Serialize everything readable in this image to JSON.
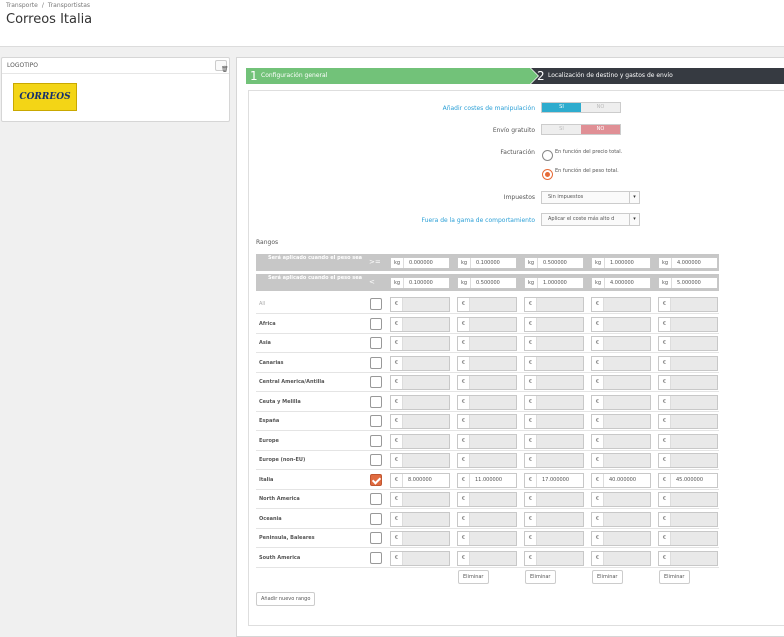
{
  "breadcrumb": {
    "items": [
      "Transporte",
      "Transportistas"
    ],
    "sep": "/"
  },
  "page_title": "Correos Italia",
  "logo_panel": {
    "title": "LOGOTIPO",
    "logo_text": "CORREOS"
  },
  "wizard": {
    "steps": [
      {
        "num": "1",
        "label": "Configuración general"
      },
      {
        "num": "2",
        "label": "Localización de destino y gastos de envío"
      }
    ]
  },
  "form": {
    "handling": {
      "label": "Añadir costes de manipulación",
      "yes": "SI",
      "no": "NO",
      "value": "SI"
    },
    "free": {
      "label": "Envío gratuito",
      "yes": "SI",
      "no": "NO",
      "value": "NO"
    },
    "billing": {
      "label": "Facturación",
      "opt1": "En función del precio total.",
      "opt2": "En función del peso total.",
      "selected": "opt2"
    },
    "tax": {
      "label": "Impuestos",
      "value": "Sin impuestos"
    },
    "out_of_range": {
      "label": "Fuera de la gama de comportamiento",
      "value": "Aplicar el coste más alto d"
    }
  },
  "ranges": {
    "title": "Rangos",
    "header_label": "Será aplicado cuando el peso sea",
    "op_ge": ">=",
    "op_lt": "<",
    "unit": "kg",
    "currency": "€",
    "from": [
      "0.000000",
      "0.100000",
      "0.500000",
      "1.000000",
      "4.000000"
    ],
    "to": [
      "0.100000",
      "0.500000",
      "1.000000",
      "4.000000",
      "5.000000"
    ],
    "zones": [
      {
        "name": "All",
        "checked": false,
        "prices": [
          "",
          "",
          "",
          "",
          ""
        ]
      },
      {
        "name": "Africa",
        "checked": false,
        "prices": [
          "",
          "",
          "",
          "",
          ""
        ]
      },
      {
        "name": "Asia",
        "checked": false,
        "prices": [
          "",
          "",
          "",
          "",
          ""
        ]
      },
      {
        "name": "Canarias",
        "checked": false,
        "prices": [
          "",
          "",
          "",
          "",
          ""
        ]
      },
      {
        "name": "Central America/Antilla",
        "checked": false,
        "prices": [
          "",
          "",
          "",
          "",
          ""
        ]
      },
      {
        "name": "Ceuta y Melilla",
        "checked": false,
        "prices": [
          "",
          "",
          "",
          "",
          ""
        ]
      },
      {
        "name": "España",
        "checked": false,
        "prices": [
          "",
          "",
          "",
          "",
          ""
        ]
      },
      {
        "name": "Europe",
        "checked": false,
        "prices": [
          "",
          "",
          "",
          "",
          ""
        ]
      },
      {
        "name": "Europe (non-EU)",
        "checked": false,
        "prices": [
          "",
          "",
          "",
          "",
          ""
        ]
      },
      {
        "name": "Italia",
        "checked": true,
        "prices": [
          "8.000000",
          "11.000000",
          "17.000000",
          "40.000000",
          "45.000000"
        ]
      },
      {
        "name": "North America",
        "checked": false,
        "prices": [
          "",
          "",
          "",
          "",
          ""
        ]
      },
      {
        "name": "Oceania",
        "checked": false,
        "prices": [
          "",
          "",
          "",
          "",
          ""
        ]
      },
      {
        "name": "Peninsula, Baleares",
        "checked": false,
        "prices": [
          "",
          "",
          "",
          "",
          ""
        ]
      },
      {
        "name": "South America",
        "checked": false,
        "prices": [
          "",
          "",
          "",
          "",
          ""
        ]
      }
    ],
    "delete_label": "Eliminar",
    "add_label": "Añadir nuevo rango"
  }
}
